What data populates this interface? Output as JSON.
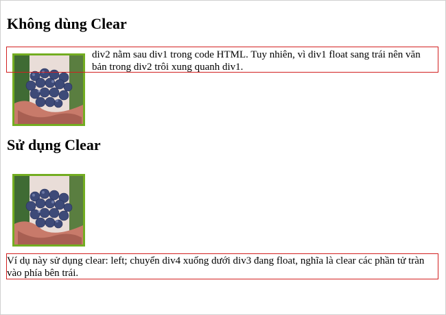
{
  "sections": [
    {
      "heading": "Không dùng Clear",
      "text": "div2 nằm sau div1 trong code HTML. Tuy nhiên, vì div1 float sang trái nên văn bản trong div2 trôi xung quanh div1."
    },
    {
      "heading": "Sử dụng Clear",
      "text": "Ví dụ này sử dụng clear: left; chuyển div4 xuống dưới div3 đang float, nghĩa là clear các phần tử tràn vào phía bên trái."
    }
  ],
  "image": {
    "icon": "grapes-in-hand-photo",
    "border_color": "#73ad21"
  },
  "colors": {
    "box_border": "#d21f1f"
  }
}
